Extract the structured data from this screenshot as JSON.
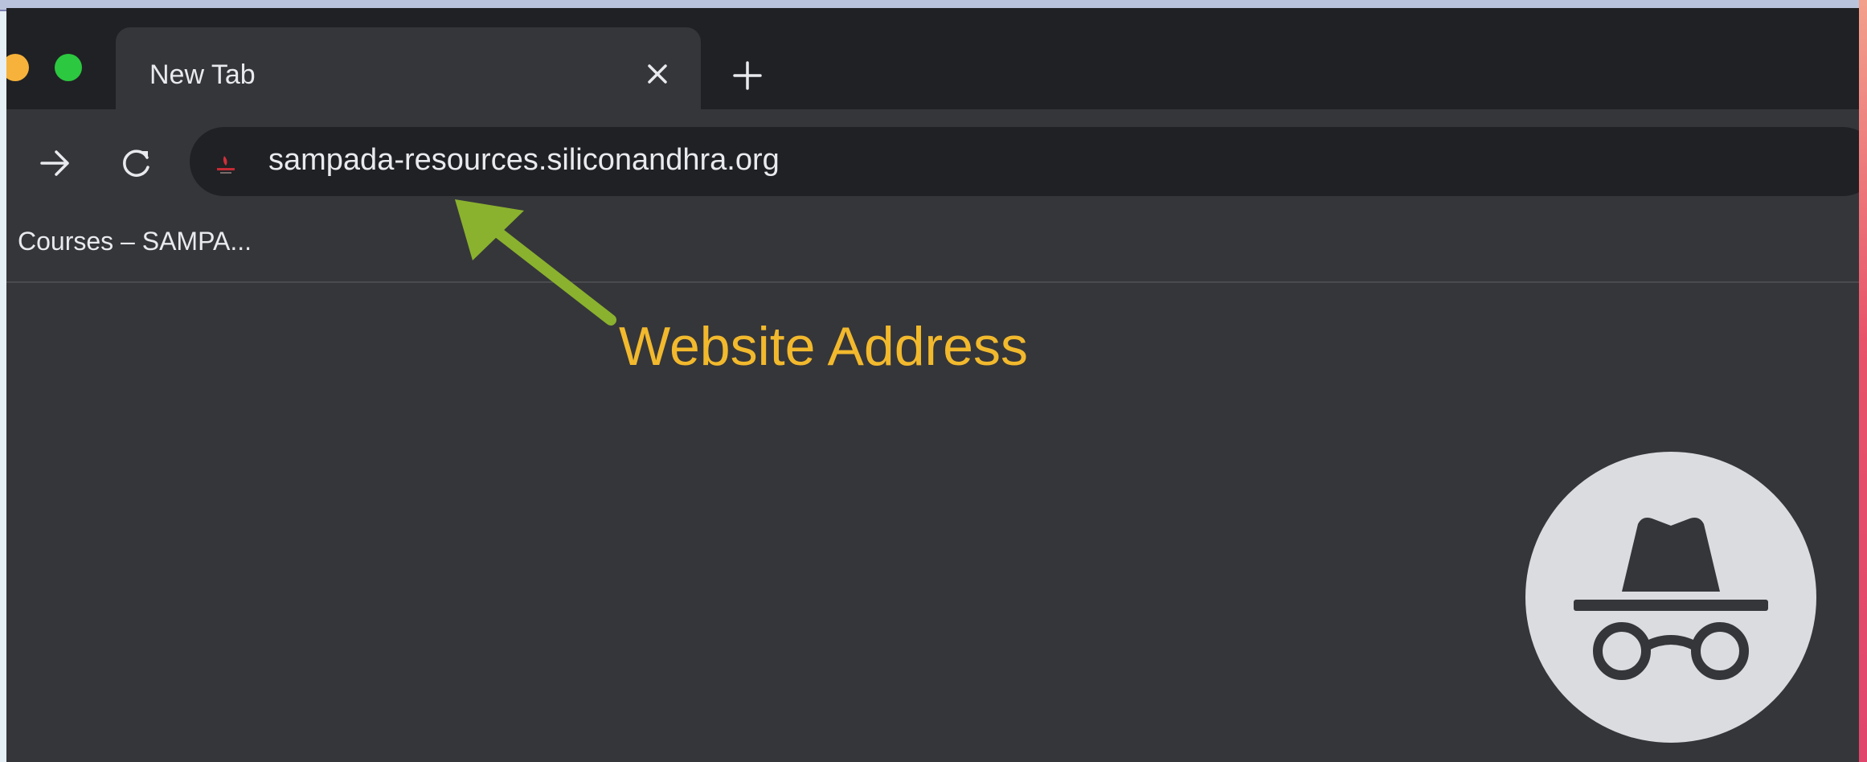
{
  "tab": {
    "title": "New Tab"
  },
  "omnibox": {
    "url": "sampada-resources.siliconandhra.org"
  },
  "bookmarks": [
    {
      "label": "Courses – SAMPA..."
    }
  ],
  "annotation": {
    "label": "Website Address"
  },
  "icons": [
    "close-icon",
    "plus-icon",
    "arrow-right-icon",
    "reload-icon",
    "site-favicon",
    "incognito-icon"
  ],
  "colors": {
    "window_bg": "#35363a",
    "tab_strip_bg": "#202124",
    "annotation_text": "#f2b92d",
    "annotation_arrow": "#8ab22e",
    "traffic_yellow": "#f6b23a",
    "traffic_green": "#2cc840"
  }
}
